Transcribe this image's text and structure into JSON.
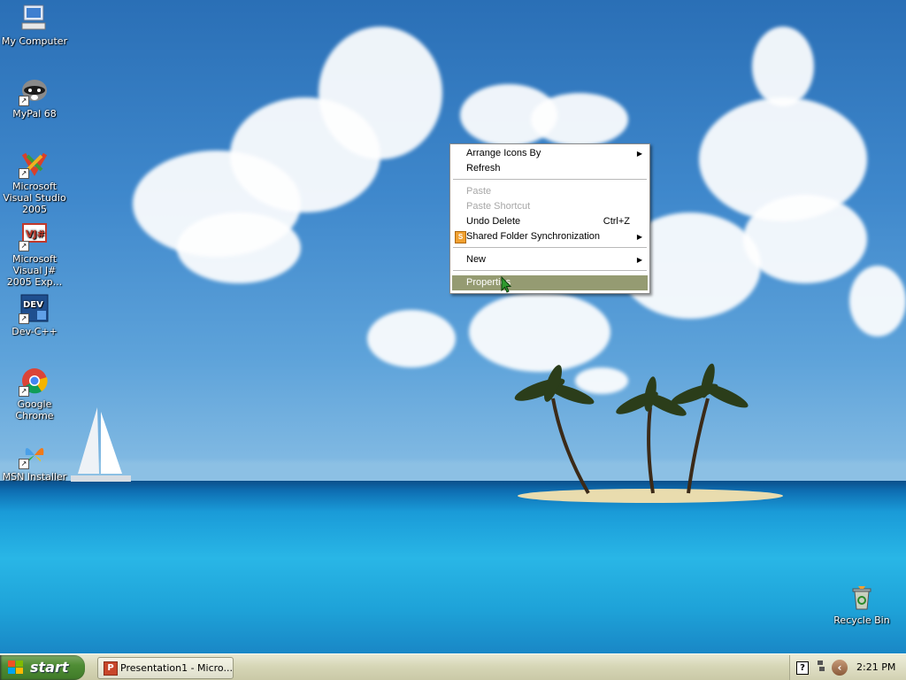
{
  "desktop_icons": [
    {
      "label": "My Computer",
      "icon": "my-computer-icon"
    },
    {
      "label": "MyPal 68",
      "icon": "mypal-raccoon-icon"
    },
    {
      "label": "Microsoft Visual Studio 2005",
      "icon": "visual-studio-icon"
    },
    {
      "label": "Microsoft Visual J# 2005 Exp...",
      "icon": "visual-jsharp-icon"
    },
    {
      "label": "Dev-C++",
      "icon": "dev-cpp-icon"
    },
    {
      "label": "Google Chrome",
      "icon": "google-chrome-icon"
    },
    {
      "label": "MSN Installer",
      "icon": "msn-butterfly-icon"
    },
    {
      "label": "Recycle Bin",
      "icon": "recycle-bin-icon"
    }
  ],
  "context_menu": {
    "items": [
      {
        "label": "Arrange Icons By",
        "submenu": true,
        "enabled": true
      },
      {
        "label": "Refresh",
        "enabled": true
      },
      {
        "label": "Paste",
        "enabled": false
      },
      {
        "label": "Paste Shortcut",
        "enabled": false
      },
      {
        "label": "Undo Delete",
        "shortcut": "Ctrl+Z",
        "enabled": true
      },
      {
        "label": "Shared Folder Synchronization",
        "submenu": true,
        "enabled": true,
        "icon": "shared-folder-sync-icon"
      },
      {
        "label": "New",
        "submenu": true,
        "enabled": true
      },
      {
        "label": "Properties",
        "enabled": true,
        "highlighted": true
      }
    ],
    "submenu_arrow": "▶"
  },
  "taskbar": {
    "start_label": "start",
    "task_button_label": "Presentation1 - Micro...",
    "tray_help": "?",
    "tray_chevron": "‹",
    "clock": "2:21 PM"
  },
  "colors": {
    "menu_highlight": "#959b72",
    "taskbar": "#d6d6b6",
    "start_button": "#4f8d35"
  }
}
